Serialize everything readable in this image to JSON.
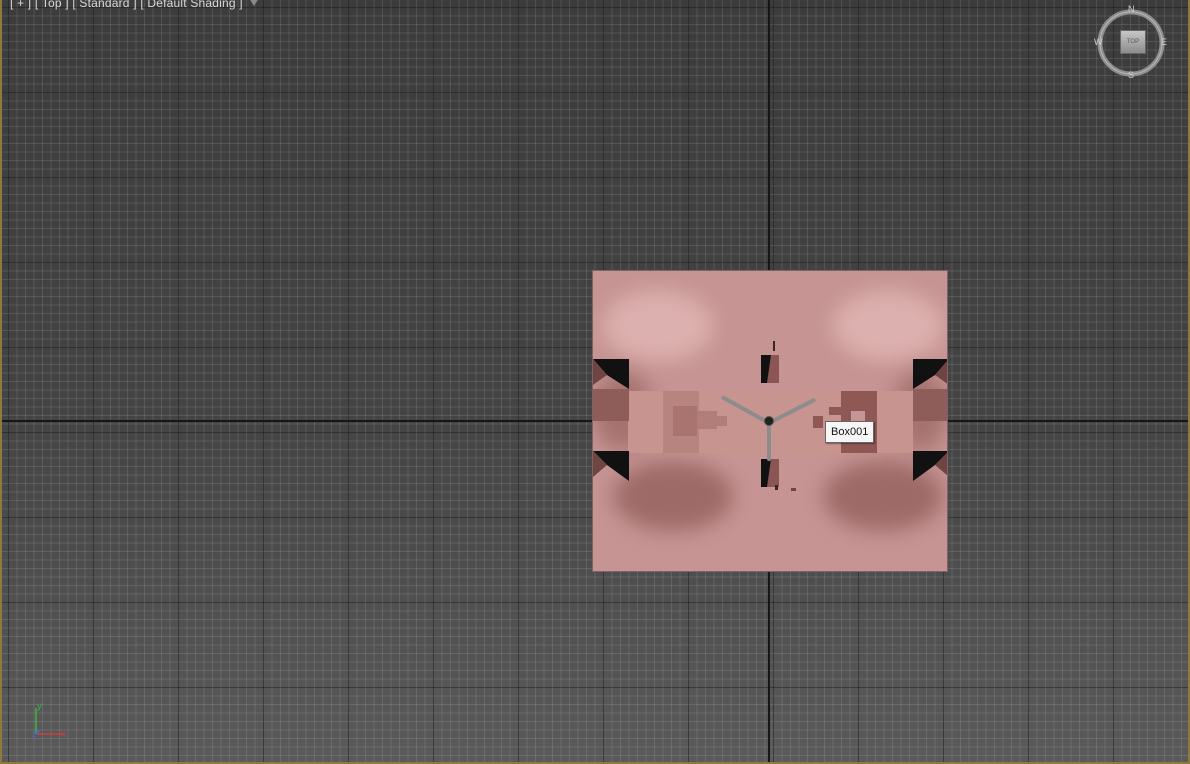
{
  "viewport": {
    "labels": {
      "plus": "[ + ]",
      "view": "[ Top ]",
      "visual_style": "[ Standard ]",
      "shading": "[ Default Shading ]"
    },
    "filter_icon": "funnel-icon"
  },
  "object": {
    "tooltip": "Box001",
    "material_color": "#c69593"
  },
  "viewcube": {
    "n": "N",
    "s": "S",
    "e": "E",
    "w": "W",
    "face": "TOP"
  },
  "axis_triad": {
    "x": "x",
    "y": "y",
    "z": "z"
  },
  "colors": {
    "frame_border": "#8d7a3c",
    "axis_x": "#d23c3c",
    "axis_y": "#3cb43c",
    "axis_z": "#3c6ed2"
  }
}
